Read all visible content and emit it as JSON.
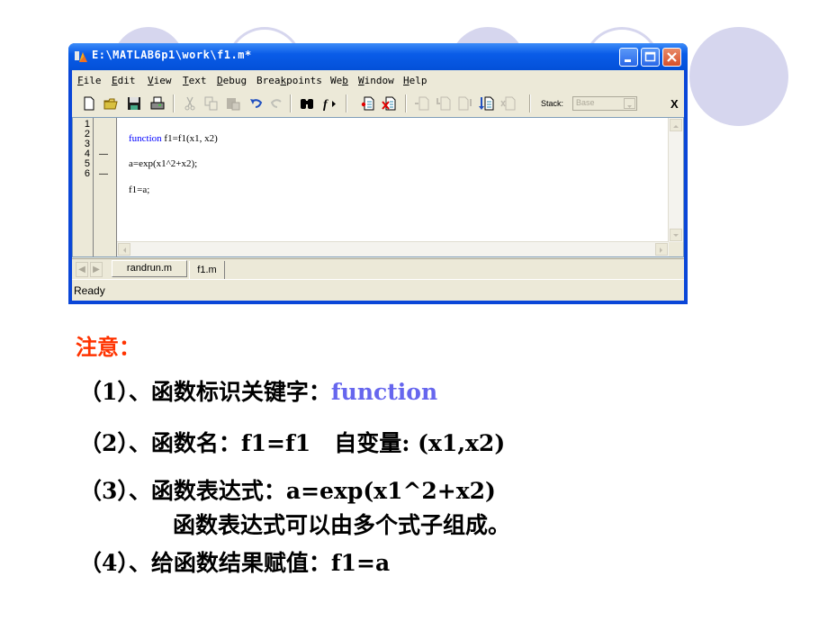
{
  "window": {
    "title": "E:\\MATLAB6p1\\work\\f1.m*",
    "controls": [
      "minimize",
      "maximize",
      "close"
    ]
  },
  "menubar": {
    "items": [
      {
        "label": "File",
        "mnemonic": "F"
      },
      {
        "label": "Edit",
        "mnemonic": "E"
      },
      {
        "label": "View",
        "mnemonic": "V"
      },
      {
        "label": "Text",
        "mnemonic": "T"
      },
      {
        "label": "Debug",
        "mnemonic": "D"
      },
      {
        "label": "Breakpoints",
        "mnemonic": "k"
      },
      {
        "label": "Web",
        "mnemonic": "b"
      },
      {
        "label": "Window",
        "mnemonic": "W"
      },
      {
        "label": "Help",
        "mnemonic": "H"
      }
    ]
  },
  "toolbar": {
    "icons": [
      "new-file-icon",
      "open-folder-icon",
      "save-icon",
      "print-icon",
      "cut-icon",
      "copy-icon",
      "paste-icon",
      "undo-icon",
      "redo-icon",
      "find-icon",
      "function-browser-icon",
      "set-breakpoint-icon",
      "clear-breakpoints-icon",
      "step-icon",
      "step-in-icon",
      "step-out-icon",
      "continue-icon",
      "exit-debug-icon"
    ],
    "stack_label": "Stack:",
    "stack_value": "Base",
    "close_label": "X"
  },
  "editor": {
    "lines": [
      {
        "num": "1",
        "dash": "",
        "code": ""
      },
      {
        "num": "2",
        "dash": "",
        "keyword": "function",
        "code": " f1=f1(x1, x2)"
      },
      {
        "num": "3",
        "dash": "",
        "code": ""
      },
      {
        "num": "4",
        "dash": "—",
        "code": "a=exp(x1^2+x2);"
      },
      {
        "num": "5",
        "dash": "",
        "code": ""
      },
      {
        "num": "6",
        "dash": "—",
        "code": "f1=a;"
      }
    ]
  },
  "tabs": [
    {
      "label": "randrun.m",
      "active": false
    },
    {
      "label": "f1.m",
      "active": true
    }
  ],
  "status": "Ready",
  "notes": {
    "title": "注意：",
    "item1_prefix": "（1）、函数标识关键字：",
    "item1_keyword": "function",
    "item2": "（2）、函数名：f1=f1   自变量: (x1,x2)",
    "item3": "（3）、函数表达式：a=exp(x1^2+x2)",
    "item3_cont": "函数表达式可以由多个式子组成。",
    "item4": "（4）、给函数结果赋值：f1=a"
  },
  "colors": {
    "title_accent": "#ff3300",
    "keyword_blue": "#6666ee",
    "titlebar_blue": "#0a5ce8",
    "deco_circle": "#d6d6ee"
  }
}
